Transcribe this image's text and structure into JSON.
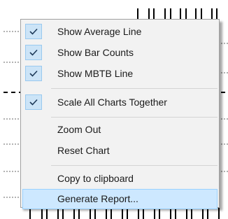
{
  "menu": {
    "items": [
      {
        "label": "Show Average Line",
        "checked": true
      },
      {
        "label": "Show Bar Counts",
        "checked": true
      },
      {
        "label": "Show MBTB Line",
        "checked": true
      },
      {
        "label": "Scale All Charts Together",
        "checked": true
      },
      {
        "label": "Zoom Out",
        "checked": false
      },
      {
        "label": "Reset Chart",
        "checked": false
      },
      {
        "label": "Copy to clipboard",
        "checked": false
      },
      {
        "label": "Generate Report...",
        "checked": false,
        "highlighted": true
      }
    ],
    "colors": {
      "background": "#f2f2f2",
      "highlight": "#cde8ff",
      "highlight_border": "#99d1ff",
      "check_background": "#cce4f7",
      "check_mark": "#1f3b5a"
    }
  }
}
